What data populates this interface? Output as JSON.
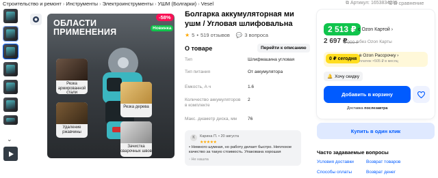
{
  "breadcrumbs": [
    "Строительство и ремонт",
    "Инструменты",
    "Электроинструменты",
    "УШМ (Болгарки)",
    "Vesel"
  ],
  "header": {
    "article": "Артикул: 1653834285",
    "favorite": "В сравнение"
  },
  "gallery": {
    "discount": "-58%",
    "novelty": "Новинка",
    "image_title": "ОБЛАСТИ ПРИМЕНЕНИЯ",
    "features": [
      "Резка армированной стали",
      "Резка дерева",
      "Удаление ржавчины",
      "Зачистка сварочных швов"
    ]
  },
  "product": {
    "title_line1": "Болгарка аккумуляторная мини",
    "title_line2": "ушм / Угловая шлифовальна",
    "rating": "5",
    "reviews": "519 отзывов",
    "questions": "3 вопроса"
  },
  "about": {
    "title": "О товаре",
    "goto_label": "Перейти к описанию",
    "specs": [
      {
        "key": "Тип",
        "value": "Шлифмашина угловая"
      },
      {
        "key": "Тип питания",
        "value": "От аккумулятора"
      },
      {
        "key": "Емкость, А·ч",
        "value": "1.6"
      },
      {
        "key": "Количество аккумуляторов в комплекте",
        "value": "2"
      },
      {
        "key": "Макс. диаметр диска, мм",
        "value": "76"
      }
    ]
  },
  "review": {
    "avatar_letter": "К",
    "author": "Карина П.",
    "date": "20 августа",
    "stars": "★★★★★",
    "text": "Немного шумная, но работу делает быстро. Неплохое качество за такую стоимость. Упакована хорошая",
    "useful": "Не нашла"
  },
  "buy": {
    "price_card": "2 513 ₽",
    "ozon_card_label": "с Ozon Картой",
    "price": "2 697 ₽",
    "old_price": "6 000 ₽",
    "no_card_label": "без Ozon Карты",
    "installment_chip": "0 ₽ сегодня",
    "installment_title": "в Ozon Рассрочку",
    "installment_sub": "платеж ×505 ₽ в месяц",
    "want_discount": "Хочу скидку",
    "add_to_cart": "Добавить в корзину",
    "delivery": "Доставка",
    "delivery_when": "послезавтра",
    "buy_one_click": "Купить в один клик"
  },
  "faq": {
    "title": "Часто задаваемые вопросы",
    "links": [
      "Условия доставки",
      "Возврат товаров",
      "Способы оплаты",
      "Возврат денег"
    ]
  },
  "colors": {
    "accent": "#005bff",
    "price_green": "#10c44c",
    "discount_pink": "#f91155",
    "installment_yellow": "#ffdd1f"
  }
}
